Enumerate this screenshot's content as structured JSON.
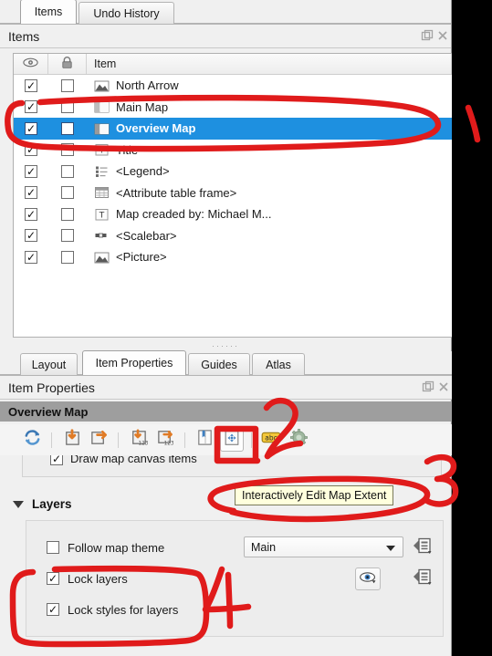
{
  "panel_top": {
    "tabs": [
      {
        "label": "Items",
        "active": true
      },
      {
        "label": "Undo History",
        "active": false
      }
    ],
    "title": "Items",
    "tool_icons": [
      "float-panel-icon",
      "close-panel-icon"
    ]
  },
  "items_tree": {
    "columns": [
      {
        "key": "visibility",
        "icon": "eye-icon",
        "label": ""
      },
      {
        "key": "lock",
        "icon": "lock-icon",
        "label": ""
      },
      {
        "key": "item",
        "icon": "",
        "label": "Item"
      }
    ],
    "rows": [
      {
        "visible": "✓",
        "locked": "",
        "icon": "picture-item-icon",
        "label": "North Arrow",
        "selected": false
      },
      {
        "visible": "✓",
        "locked": "",
        "icon": "map-item-icon",
        "label": "Main Map",
        "selected": false
      },
      {
        "visible": "✓",
        "locked": "",
        "icon": "map-item-icon",
        "label": "Overview Map",
        "selected": true
      },
      {
        "visible": "✓",
        "locked": "",
        "icon": "label-item-icon",
        "label": "Title",
        "selected": false
      },
      {
        "visible": "✓",
        "locked": "",
        "icon": "legend-item-icon",
        "label": "<Legend>",
        "selected": false
      },
      {
        "visible": "✓",
        "locked": "",
        "icon": "attribute-table-item-icon",
        "label": "<Attribute table frame>",
        "selected": false
      },
      {
        "visible": "✓",
        "locked": "",
        "icon": "label-item-icon",
        "label": "Map creaded by: Michael M...",
        "selected": false
      },
      {
        "visible": "✓",
        "locked": "",
        "icon": "scalebar-item-icon",
        "label": "<Scalebar>",
        "selected": false
      },
      {
        "visible": "✓",
        "locked": "",
        "icon": "picture-item-icon",
        "label": "<Picture>",
        "selected": false
      }
    ]
  },
  "panel_bottom": {
    "tabs": [
      {
        "label": "Layout",
        "active": false
      },
      {
        "label": "Item Properties",
        "active": true
      },
      {
        "label": "Guides",
        "active": false
      },
      {
        "label": "Atlas",
        "active": false
      }
    ],
    "title": "Item Properties",
    "tool_icons": [
      "float-panel-icon",
      "close-panel-icon"
    ],
    "group_title": "Overview Map"
  },
  "toolbar": {
    "buttons": [
      {
        "name": "refresh-view-button",
        "icon": "refresh-icon",
        "pressed": false
      },
      {
        "name": "set-map-extent-to-canvas-button",
        "icon": "map-extent-from-canvas-icon",
        "pressed": false
      },
      {
        "name": "set-canvas-to-map-extent-button",
        "icon": "canvas-from-map-extent-icon",
        "pressed": false
      },
      {
        "name": "set-map-scale-to-canvas-button",
        "icon": "map-scale-from-canvas-icon",
        "pressed": false
      },
      {
        "name": "set-canvas-scale-to-map-button",
        "icon": "canvas-scale-from-map-icon",
        "pressed": false
      },
      {
        "name": "bookmark-extent-button",
        "icon": "bookmark-icon",
        "pressed": false
      },
      {
        "name": "interactively-edit-map-extent-button",
        "icon": "edit-map-extent-icon",
        "pressed": true
      },
      {
        "name": "labeling-settings-button",
        "icon": "abc-label-icon",
        "pressed": false
      },
      {
        "name": "map-settings-button",
        "icon": "gear-map-icon",
        "pressed": false
      }
    ]
  },
  "tooltip": {
    "text": "Interactively Edit Map Extent"
  },
  "clipped_option": {
    "label": "Draw map canvas items",
    "checked": "✓"
  },
  "layers_section": {
    "title": "Layers",
    "expanded_icon": "triangle-down-icon",
    "follow_map_theme": {
      "label": "Follow map theme",
      "checked": false,
      "mark": ""
    },
    "theme_combo": {
      "value": "Main",
      "caret": "chevron-down-icon"
    },
    "lock_layers": {
      "label": "Lock layers",
      "checked": true,
      "mark": "✓"
    },
    "lock_styles": {
      "label": "Lock styles for layers",
      "checked": true,
      "mark": "✓"
    },
    "side_buttons": [
      {
        "name": "theme-data-defined-button",
        "icon": "data-defined-override-icon"
      },
      {
        "name": "show-layers-button",
        "icon": "eye-layers-icon"
      },
      {
        "name": "layers-data-defined-button",
        "icon": "data-defined-override-icon"
      }
    ]
  },
  "annotations": {
    "color": "#e01b1b",
    "marks": [
      {
        "name": "annotation-number-1",
        "text": "1"
      },
      {
        "name": "annotation-number-2",
        "text": "2"
      },
      {
        "name": "annotation-number-3",
        "text": "3"
      },
      {
        "name": "annotation-number-4",
        "text": "4"
      }
    ]
  },
  "colors": {
    "selection_blue": "#1e90e0",
    "group_bar_gray": "#9e9e9e",
    "panel_bg": "#f0f0f0",
    "tooltip_bg": "#ffffdd",
    "annotation_red": "#e01b1b"
  }
}
